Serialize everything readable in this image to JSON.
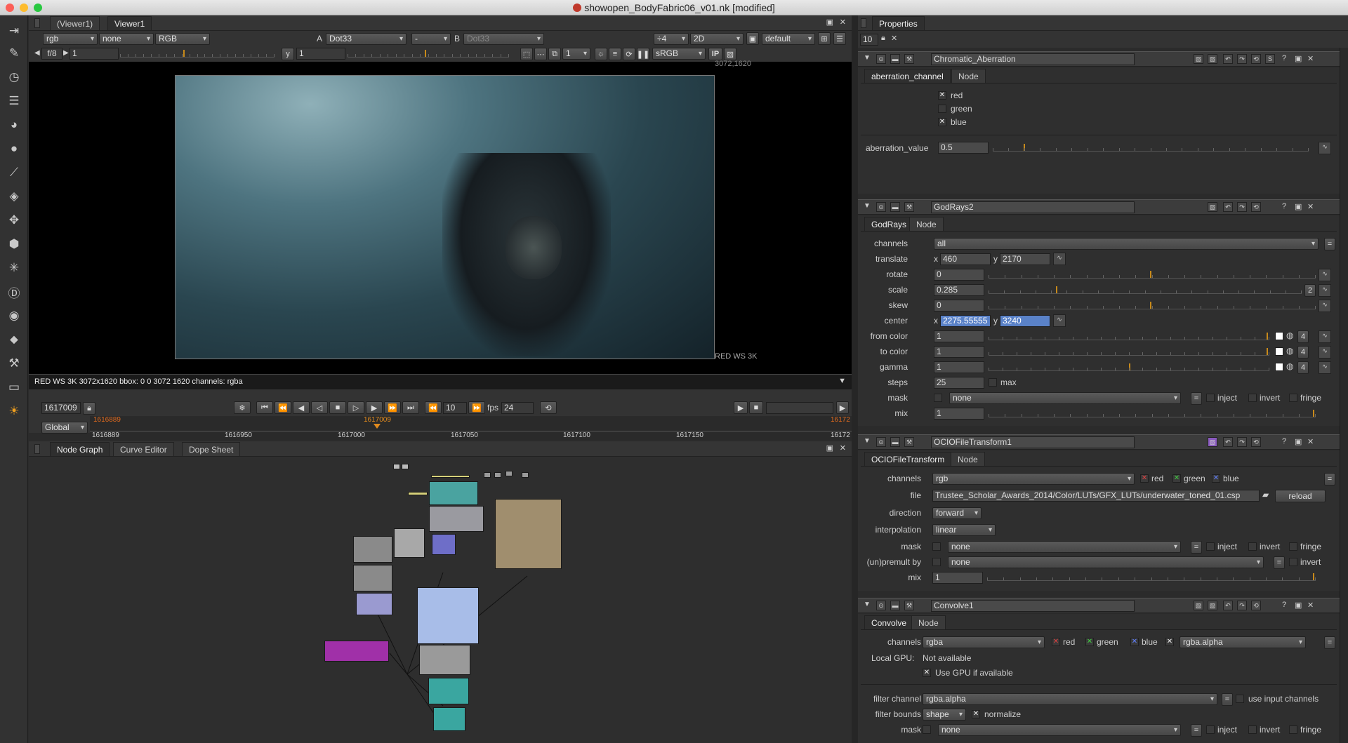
{
  "window": {
    "title": "showopen_BodyFabric06_v01.nk [modified]"
  },
  "viewer": {
    "tabs": [
      "(Viewer1)",
      "Viewer1"
    ],
    "channel": "rgb",
    "alpha": "none",
    "display": "RGB",
    "a_label": "A",
    "a_input": "Dot33",
    "op": "-",
    "b_label": "B",
    "b_input": "Dot33",
    "downrez": "÷4",
    "mode": "2D",
    "lut_preset": "default",
    "fstop": "f/8",
    "gain": "1",
    "y_label": "y",
    "gamma": "1",
    "proxy": "1",
    "colorspace": "sRGB",
    "ip": "IP",
    "corner_tr": "3072,1620",
    "format_label": "RED WS 3K",
    "info_bar": "RED WS 3K 3072x1620 bbox: 0 0 3072 1620 channels: rgba"
  },
  "timeline": {
    "current_frame": "1617009",
    "playhead_label": "1617009",
    "in_label": "1616889",
    "out_label": "16172",
    "step": "10",
    "fps_label": "fps",
    "fps": "24",
    "range_mode": "Global",
    "ticks": [
      "1616889",
      "1616950",
      "1617000",
      "1617050",
      "1617100",
      "1617150",
      "16172"
    ]
  },
  "bottom_tabs": [
    "Node Graph",
    "Curve Editor",
    "Dope Sheet"
  ],
  "properties": {
    "title": "Properties",
    "max_panels": "10",
    "chromatic": {
      "name": "Chromatic_Aberration",
      "tabs": [
        "aberration_channel",
        "Node"
      ],
      "channels": [
        {
          "label": "red",
          "checked": true
        },
        {
          "label": "green",
          "checked": false
        },
        {
          "label": "blue",
          "checked": true
        }
      ],
      "value_label": "aberration_value",
      "value": "0.5",
      "ticks": [
        "0",
        "0.5",
        "1",
        "1.5",
        "2",
        "2.5",
        "3",
        "3.5",
        "4",
        "4.5",
        "5"
      ]
    },
    "godrays": {
      "name": "GodRays2",
      "tabs": [
        "GodRays",
        "Node"
      ],
      "channels_label": "channels",
      "channels": "all",
      "translate_label": "translate",
      "tx": "460",
      "ty": "2170",
      "rotate_label": "rotate",
      "rotate": "0",
      "scale_label": "scale",
      "scale": "0.285",
      "scale_count": "2",
      "skew_label": "skew",
      "skew": "0",
      "center_label": "center",
      "cx": "2275.55555",
      "cy": "3240",
      "from_label": "from color",
      "from": "1",
      "to_label": "to color",
      "to": "1",
      "gamma_label": "gamma",
      "gamma": "1",
      "steps_label": "steps",
      "steps": "25",
      "max_label": "max",
      "mask_label": "mask",
      "mask": "none",
      "mix_label": "mix",
      "mix": "1",
      "inject": "inject",
      "invert": "invert",
      "fringe": "fringe",
      "x": "x",
      "y": "y",
      "four": "4"
    },
    "ocio": {
      "name": "OCIOFileTransform1",
      "tabs": [
        "OCIOFileTransform",
        "Node"
      ],
      "channels_label": "channels",
      "channels": "rgb",
      "red": "red",
      "green": "green",
      "blue": "blue",
      "file_label": "file",
      "file": "Trustee_Scholar_Awards_2014/Color/LUTs/GFX_LUTs/underwater_toned_01.csp",
      "reload": "reload",
      "direction_label": "direction",
      "direction": "forward",
      "interp_label": "interpolation",
      "interp": "linear",
      "mask_label": "mask",
      "mask": "none",
      "premult_label": "(un)premult by",
      "premult": "none",
      "mix_label": "mix",
      "mix": "1",
      "inject": "inject",
      "invert": "invert",
      "fringe": "fringe"
    },
    "convolve": {
      "name": "Convolve1",
      "tabs": [
        "Convolve",
        "Node"
      ],
      "channels_label": "channels",
      "channels": "rgba",
      "red": "red",
      "green": "green",
      "blue": "blue",
      "alpha_ch": "rgba.alpha",
      "gpu_label": "Local GPU:",
      "gpu": "Not available",
      "use_gpu": "Use GPU if available",
      "filter_channel_label": "filter channel",
      "filter_channel": "rgba.alpha",
      "use_input": "use input channels",
      "bounds_label": "filter bounds",
      "bounds": "shape",
      "normalize": "normalize",
      "mask_label": "mask",
      "mask": "none",
      "inject": "inject",
      "invert": "invert",
      "fringe": "fringe"
    }
  },
  "colors": {
    "accent_orange": "#e08a1e",
    "selected_blue": "#5a82c8"
  }
}
